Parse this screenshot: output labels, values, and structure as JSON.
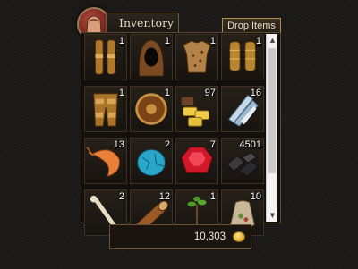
{
  "window": {
    "title": "Inventory",
    "drop_label": "Drop Items",
    "bag_icon": "bag-icon"
  },
  "inventory": {
    "items": [
      {
        "icon": "leg-armor-icon",
        "count": "1"
      },
      {
        "icon": "hood-icon",
        "count": "1"
      },
      {
        "icon": "chest-armor-icon",
        "count": "1"
      },
      {
        "icon": "gauntlets-icon",
        "count": "1"
      },
      {
        "icon": "plate-leggings-icon",
        "count": "1"
      },
      {
        "icon": "round-shield-icon",
        "count": "1"
      },
      {
        "icon": "gold-ingots-icon",
        "count": "97"
      },
      {
        "icon": "crystal-shards-icon",
        "count": "16"
      },
      {
        "icon": "shrimp-icon",
        "count": "13"
      },
      {
        "icon": "blue-egg-icon",
        "count": "2"
      },
      {
        "icon": "ruby-icon",
        "count": "7"
      },
      {
        "icon": "coal-icon",
        "count": "4501"
      },
      {
        "icon": "bone-icon",
        "count": "2"
      },
      {
        "icon": "wood-log-icon",
        "count": "12"
      },
      {
        "icon": "sapling-icon",
        "count": "1"
      },
      {
        "icon": "seed-bag-icon",
        "count": "10"
      }
    ]
  },
  "wallet": {
    "amount": "10,303",
    "currency_icon": "gold-coin-icon"
  },
  "colors": {
    "frame": "#7a5a32",
    "panel": "#120f0d",
    "text": "#e6d9c2"
  },
  "scrollbar": {
    "position": 0.0
  }
}
